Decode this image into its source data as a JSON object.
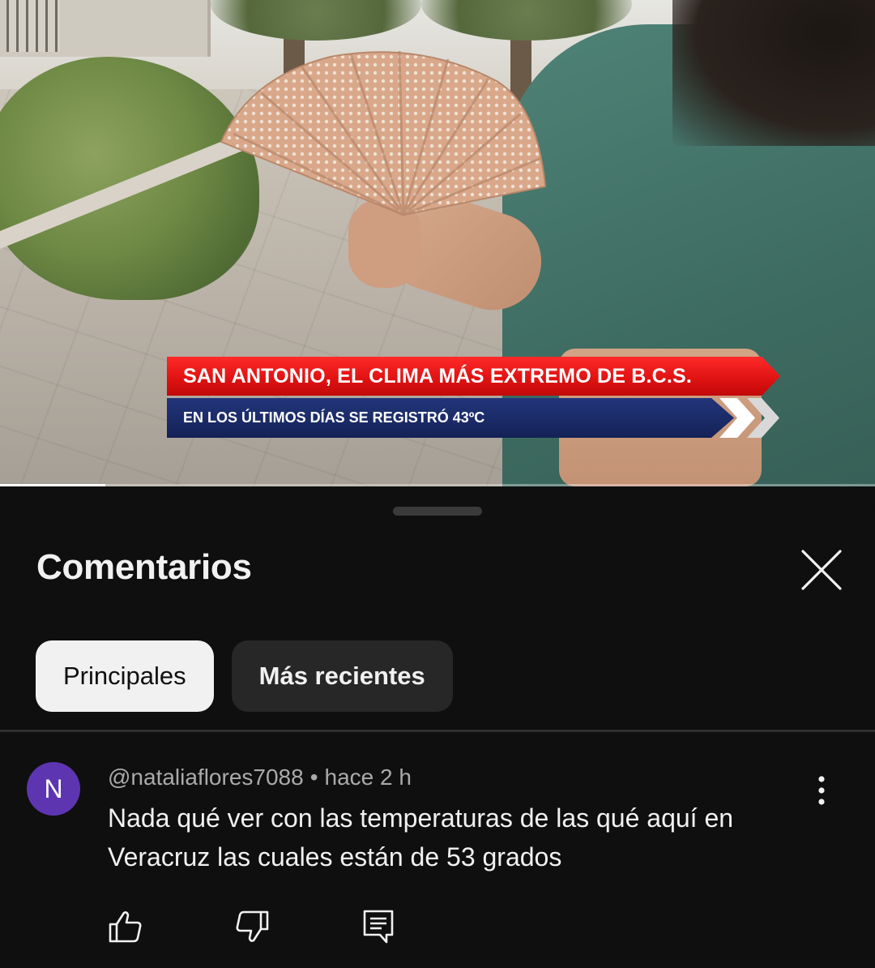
{
  "video": {
    "headline": "SAN ANTONIO, EL CLIMA MÁS EXTREMO DE B.C.S.",
    "subheadline": "EN LOS ÚLTIMOS DÍAS SE REGISTRÓ 43ºC",
    "progress_fraction": 0.12
  },
  "comments_panel": {
    "title": "Comentarios",
    "close_icon": "close-icon",
    "filters": [
      {
        "label": "Principales",
        "selected": true
      },
      {
        "label": "Más recientes",
        "selected": false
      }
    ]
  },
  "comments": [
    {
      "avatar_letter": "N",
      "avatar_color": "#5e35b1",
      "author": "@nataliaflores7088",
      "separator": "•",
      "time": "hace 2 h",
      "text": "Nada qué ver con las temperaturas de las qué aquí en Veracruz las cuales están de 53 grados",
      "actions": [
        "like-icon",
        "dislike-icon",
        "reply-icon"
      ]
    }
  ],
  "colors": {
    "background": "#0f0f0f",
    "chip_active_bg": "#f1f1f1",
    "chip_inactive_bg": "#272727",
    "headline_red": "#e11313",
    "subheadline_blue": "#1a2a66"
  }
}
